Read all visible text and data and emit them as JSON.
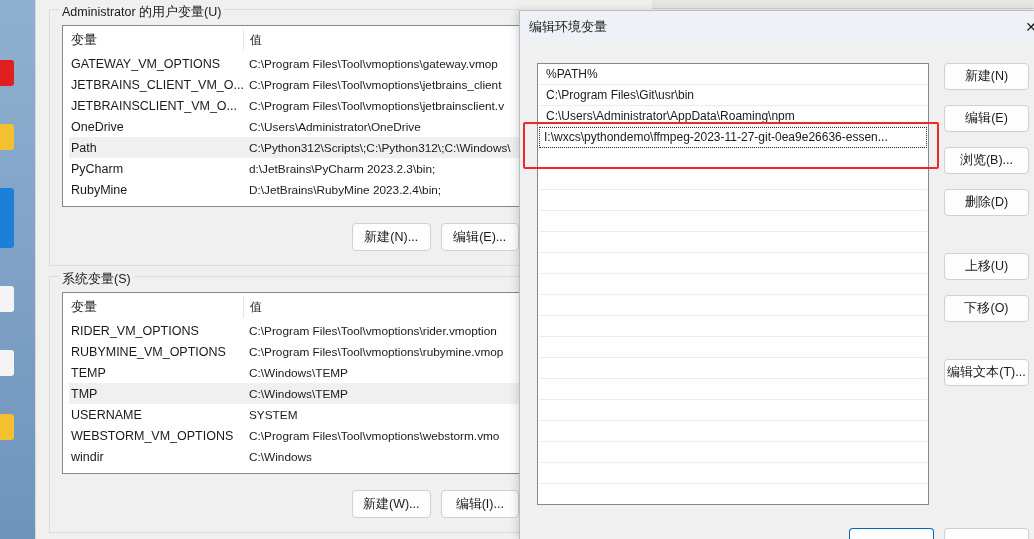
{
  "background_window": {
    "groups": [
      {
        "title": "Administrator 的用户变量(U)",
        "columns": [
          "变量",
          "值"
        ],
        "rows": [
          {
            "name": "GATEWAY_VM_OPTIONS",
            "value": "C:\\Program Files\\Tool\\vmoptions\\gateway.vmop",
            "selected": false
          },
          {
            "name": "JETBRAINS_CLIENT_VM_O...",
            "value": "C:\\Program Files\\Tool\\vmoptions\\jetbrains_client",
            "selected": false
          },
          {
            "name": "JETBRAINSCLIENT_VM_O...",
            "value": "C:\\Program Files\\Tool\\vmoptions\\jetbrainsclient.v",
            "selected": false
          },
          {
            "name": "OneDrive",
            "value": "C:\\Users\\Administrator\\OneDrive",
            "selected": false
          },
          {
            "name": "Path",
            "value": "C:\\Python312\\Scripts\\;C:\\Python312\\;C:\\Windows\\",
            "selected": true
          },
          {
            "name": "PyCharm",
            "value": "d:\\JetBrains\\PyCharm 2023.2.3\\bin;",
            "selected": false
          },
          {
            "name": "RubyMine",
            "value": "D:\\JetBrains\\RubyMine 2023.2.4\\bin;",
            "selected": false
          }
        ],
        "buttons": [
          "新建(N)...",
          "编辑(E)..."
        ]
      },
      {
        "title": "系统变量(S)",
        "columns": [
          "变量",
          "值"
        ],
        "rows": [
          {
            "name": "RIDER_VM_OPTIONS",
            "value": "C:\\Program Files\\Tool\\vmoptions\\rider.vmoption",
            "selected": false
          },
          {
            "name": "RUBYMINE_VM_OPTIONS",
            "value": "C:\\Program Files\\Tool\\vmoptions\\rubymine.vmop",
            "selected": false
          },
          {
            "name": "TEMP",
            "value": "C:\\Windows\\TEMP",
            "selected": false
          },
          {
            "name": "TMP",
            "value": "C:\\Windows\\TEMP",
            "selected": true
          },
          {
            "name": "USERNAME",
            "value": "SYSTEM",
            "selected": false
          },
          {
            "name": "WEBSTORM_VM_OPTIONS",
            "value": "C:\\Program Files\\Tool\\vmoptions\\webstorm.vmo",
            "selected": false
          },
          {
            "name": "windir",
            "value": "C:\\Windows",
            "selected": false
          }
        ],
        "buttons": [
          "新建(W)...",
          "编辑(I)..."
        ]
      }
    ]
  },
  "dialog": {
    "title": "编辑环境变量",
    "close": "✕",
    "entries": [
      {
        "text": "%PATH%",
        "selected": false
      },
      {
        "text": "C:\\Program Files\\Git\\usr\\bin",
        "selected": false
      },
      {
        "text": "C:\\Users\\Administrator\\AppData\\Roaming\\npm",
        "selected": false
      },
      {
        "text": "I:\\wxcs\\pythondemo\\ffmpeg-2023-11-27-git-0ea9e26636-essen...",
        "selected": true
      }
    ],
    "button_groups": [
      [
        "新建(N)",
        "编辑(E)",
        "浏览(B)...",
        "删除(D)"
      ],
      [
        "上移(U)",
        "下移(O)"
      ],
      [
        "编辑文本(T)..."
      ]
    ],
    "footer_buttons": [
      {
        "kind": "default"
      },
      {
        "kind": "normal"
      }
    ]
  }
}
